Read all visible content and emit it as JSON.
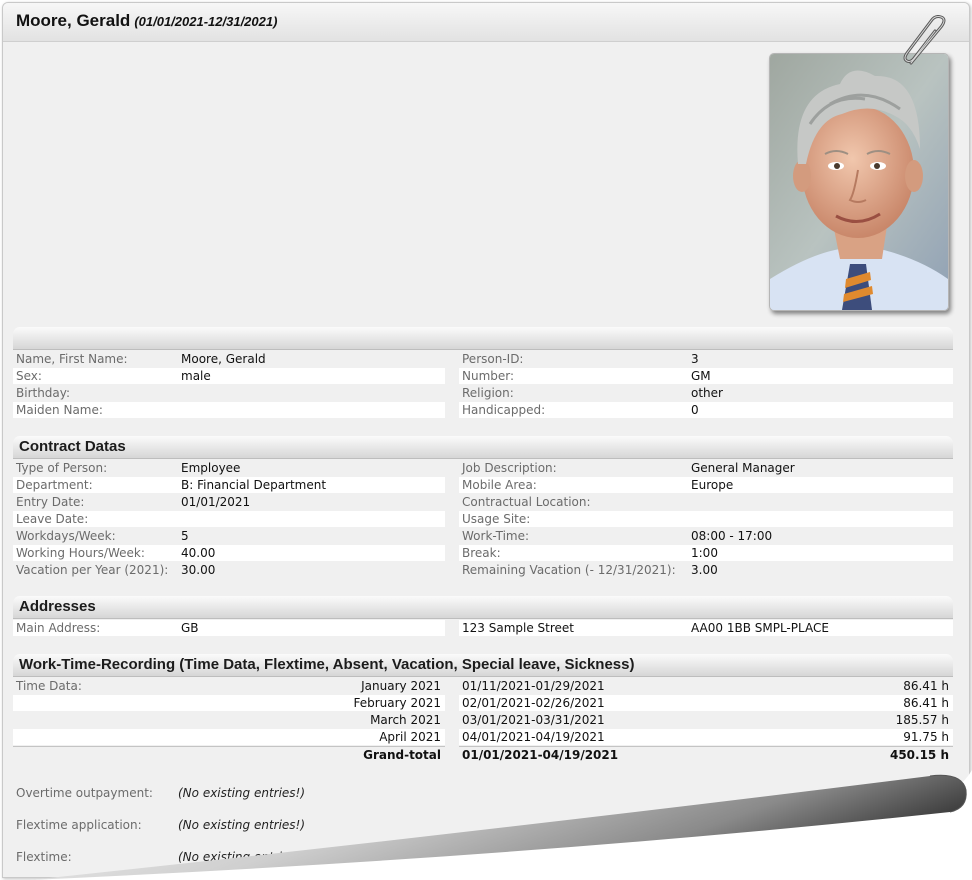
{
  "header": {
    "name": "Moore, Gerald",
    "period": "(01/01/2021-12/31/2021)"
  },
  "icons": {
    "attach": "paperclip-icon",
    "photo": "employee-photo"
  },
  "personal": {
    "left": [
      {
        "label": "Name, First Name:",
        "value": "Moore, Gerald"
      },
      {
        "label": "Sex:",
        "value": "male"
      },
      {
        "label": "Birthday:",
        "value": ""
      },
      {
        "label": "Maiden Name:",
        "value": ""
      }
    ],
    "right": [
      {
        "label": "Person-ID:",
        "value": "3"
      },
      {
        "label": "Number:",
        "value": "GM"
      },
      {
        "label": "Religion:",
        "value": "other"
      },
      {
        "label": "Handicapped:",
        "value": "0"
      }
    ]
  },
  "contract": {
    "title": "Contract Datas",
    "left": [
      {
        "label": "Type of Person:",
        "value": "Employee"
      },
      {
        "label": "Department:",
        "value": "B: Financial Department"
      },
      {
        "label": "Entry Date:",
        "value": "01/01/2021"
      },
      {
        "label": "Leave Date:",
        "value": ""
      },
      {
        "label": "Workdays/Week:",
        "value": "5"
      },
      {
        "label": "Working Hours/Week:",
        "value": "40.00"
      },
      {
        "label": "Vacation per Year (2021):",
        "value": "30.00"
      }
    ],
    "right": [
      {
        "label": "Job Description:",
        "value": "General Manager"
      },
      {
        "label": "Mobile Area:",
        "value": "Europe"
      },
      {
        "label": "Contractual Location:",
        "value": ""
      },
      {
        "label": "Usage Site:",
        "value": ""
      },
      {
        "label": "Work-Time:",
        "value": "08:00 - 17:00"
      },
      {
        "label": "Break:",
        "value": "1:00"
      },
      {
        "label": "Remaining Vacation (- 12/31/2021):",
        "value": "3.00"
      }
    ]
  },
  "addresses": {
    "title": "Addresses",
    "label": "Main Address:",
    "country": "GB",
    "street": "123 Sample Street",
    "city": "AA00 1BB SMPL-PLACE"
  },
  "worktime": {
    "title": "Work-Time-Recording (Time Data, Flextime, Absent, Vacation, Special leave, Sickness)",
    "label": "Time Data:",
    "rows": [
      {
        "month": "January 2021",
        "range": "01/11/2021-01/29/2021",
        "hours": "86.41 h"
      },
      {
        "month": "February 2021",
        "range": "02/01/2021-02/26/2021",
        "hours": "86.41 h"
      },
      {
        "month": "March 2021",
        "range": "03/01/2021-03/31/2021",
        "hours": "185.57 h"
      },
      {
        "month": "April 2021",
        "range": "04/01/2021-04/19/2021",
        "hours": "91.75 h"
      }
    ],
    "total": {
      "label": "Grand-total",
      "range": "01/01/2021-04/19/2021",
      "hours": "450.15 h"
    }
  },
  "other": [
    {
      "label": "Overtime outpayment:",
      "value": "(No existing entries!)"
    },
    {
      "label": "Flextime application:",
      "value": "(No existing entries!)"
    },
    {
      "label": "Flextime:",
      "value": "(No existing entries!)"
    }
  ]
}
